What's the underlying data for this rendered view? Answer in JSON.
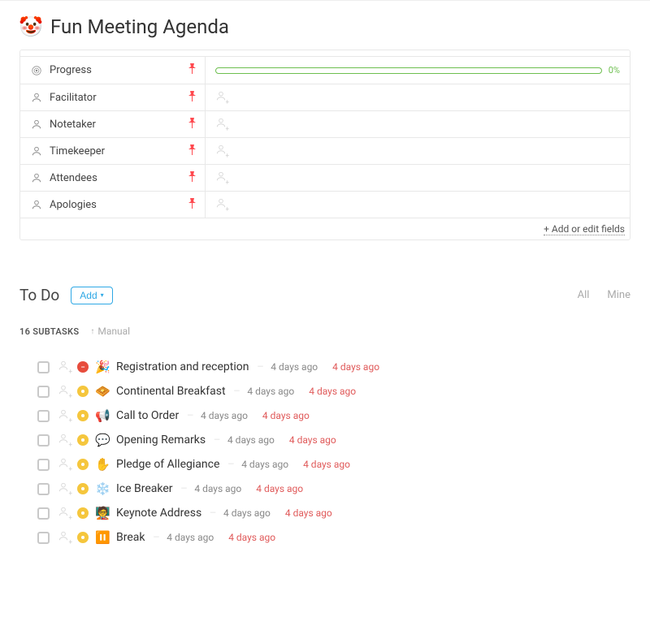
{
  "header": {
    "emoji": "🤡",
    "title": "Fun Meeting Agenda"
  },
  "fields": [
    {
      "icon": "target",
      "label": "Progress",
      "type": "progress",
      "percent": "0%"
    },
    {
      "icon": "person",
      "label": "Facilitator",
      "type": "person"
    },
    {
      "icon": "person",
      "label": "Notetaker",
      "type": "person"
    },
    {
      "icon": "person",
      "label": "Timekeeper",
      "type": "person"
    },
    {
      "icon": "person",
      "label": "Attendees",
      "type": "person"
    },
    {
      "icon": "person",
      "label": "Apologies",
      "type": "person"
    }
  ],
  "add_fields": "+ Add or edit fields",
  "todo": {
    "title": "To Do",
    "add_label": "Add",
    "filters": {
      "all": "All",
      "mine": "Mine"
    },
    "subtasks_count": "16 SUBTASKS",
    "sort_label": "Manual"
  },
  "subtasks": [
    {
      "status": "red",
      "emoji": "🎉",
      "title": "Registration and reception",
      "date1": "4 days ago",
      "date2": "4 days ago"
    },
    {
      "status": "yellow",
      "emoji": "🧇",
      "title": "Continental Breakfast",
      "date1": "4 days ago",
      "date2": "4 days ago"
    },
    {
      "status": "yellow",
      "emoji": "📢",
      "title": "Call to Order",
      "date1": "4 days ago",
      "date2": "4 days ago"
    },
    {
      "status": "yellow",
      "emoji": "💬",
      "title": "Opening Remarks",
      "date1": "4 days ago",
      "date2": "4 days ago"
    },
    {
      "status": "yellow",
      "emoji": "✋",
      "title": "Pledge of Allegiance",
      "date1": "4 days ago",
      "date2": "4 days ago"
    },
    {
      "status": "yellow",
      "emoji": "❄️",
      "title": "Ice Breaker",
      "date1": "4 days ago",
      "date2": "4 days ago"
    },
    {
      "status": "yellow",
      "emoji": "🧑‍🏫",
      "title": "Keynote Address",
      "date1": "4 days ago",
      "date2": "4 days ago"
    },
    {
      "status": "yellow",
      "emoji": "⏸️",
      "title": "Break",
      "date1": "4 days ago",
      "date2": "4 days ago"
    }
  ]
}
